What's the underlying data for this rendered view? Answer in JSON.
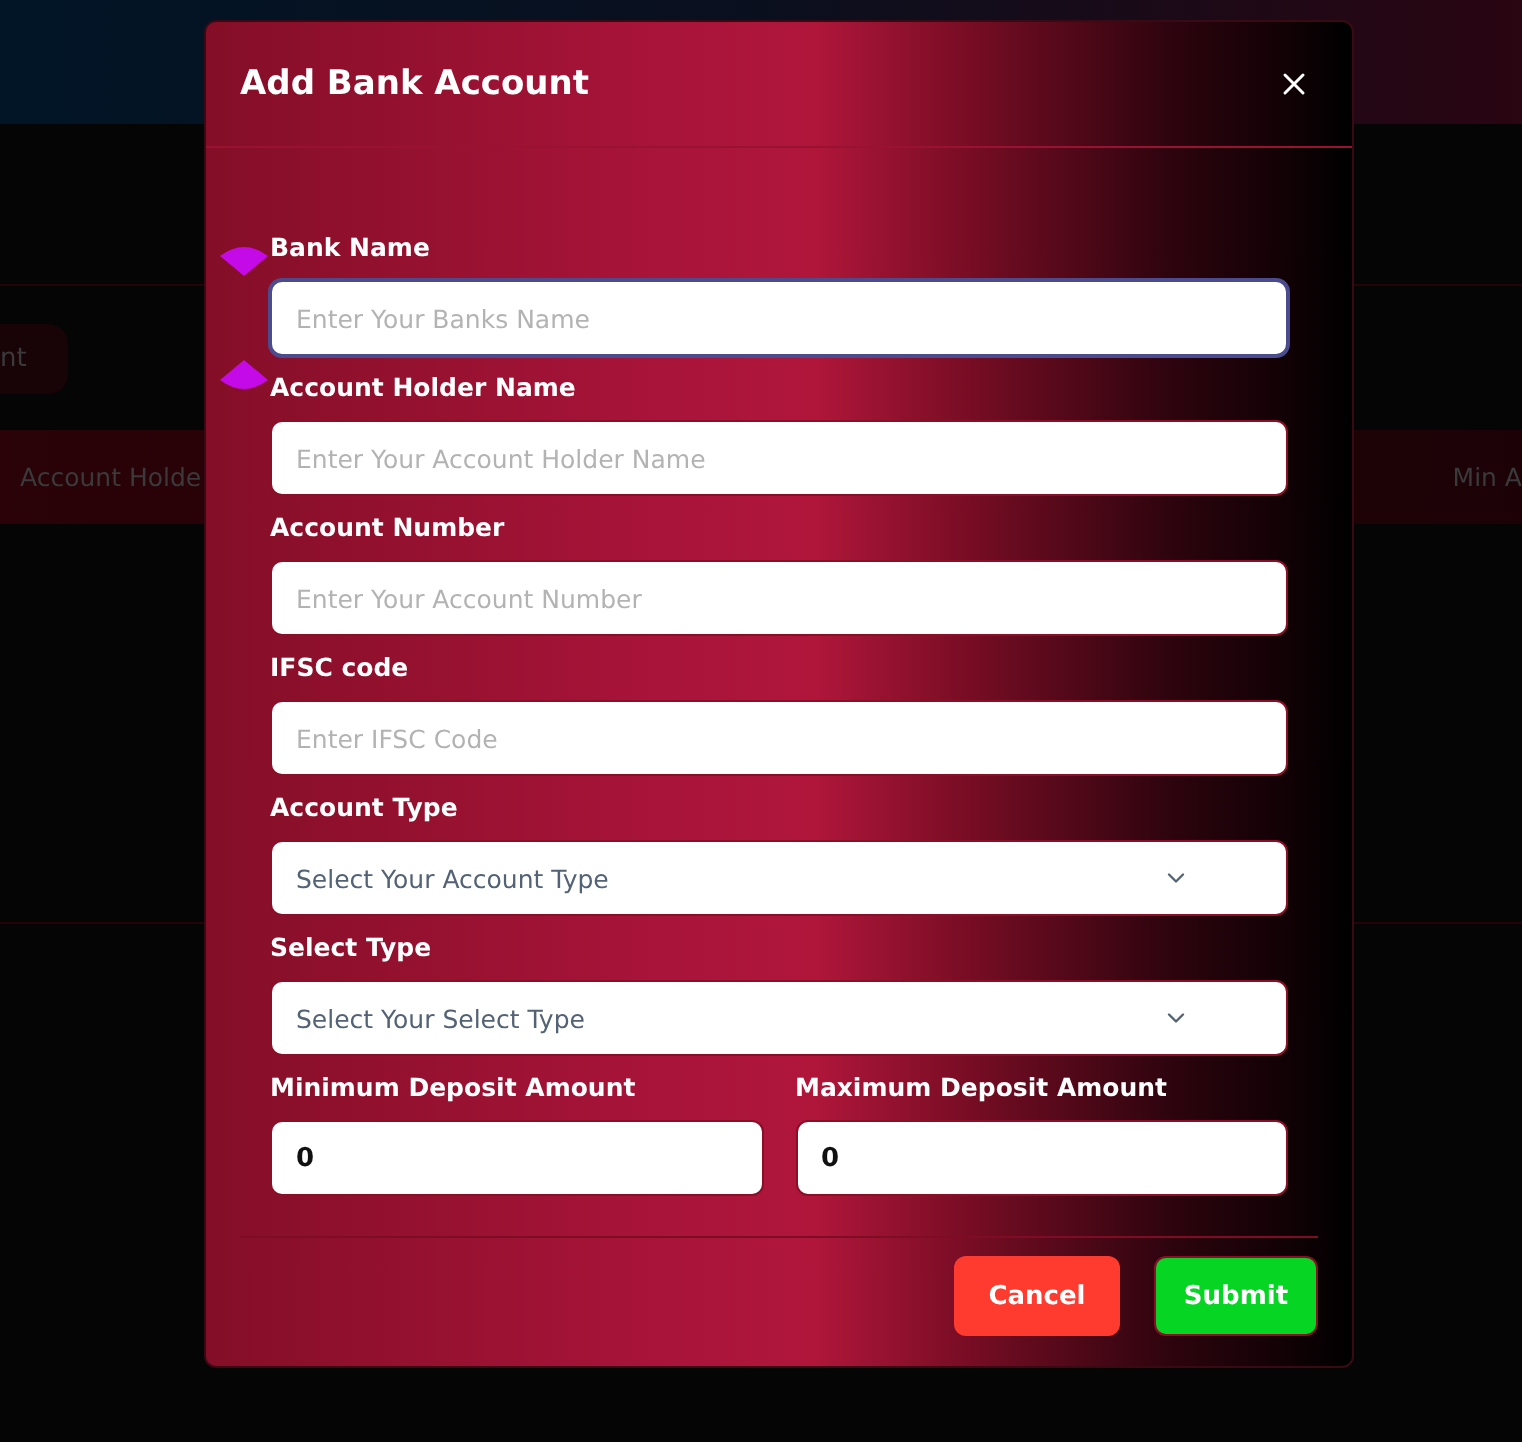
{
  "background_page": {
    "toolbar_button": {
      "label": "nt"
    },
    "table": {
      "columns": [
        {
          "label": "Account Holde"
        },
        {
          "label": "Min A"
        }
      ]
    }
  },
  "dialog": {
    "title": "Add Bank Account",
    "fields": [
      {
        "kind": "text",
        "label": "Bank Name",
        "placeholder": "Enter Your Banks Name",
        "focused": true
      },
      {
        "kind": "text",
        "label": "Account Holder Name",
        "placeholder": "Enter Your Account Holder Name",
        "focused": false
      },
      {
        "kind": "text",
        "label": "Account Number",
        "placeholder": "Enter Your Account Number",
        "focused": false
      },
      {
        "kind": "text",
        "label": "IFSC code",
        "placeholder": "Enter IFSC Code",
        "focused": false
      },
      {
        "kind": "select",
        "label": "Account Type",
        "placeholder": "Select Your Account Type",
        "focused": false
      },
      {
        "kind": "select",
        "label": "Select Type",
        "placeholder": "Select Your Select Type",
        "focused": false
      }
    ],
    "amount_fields": [
      {
        "label": "Minimum Deposit Amount",
        "value": "0"
      },
      {
        "label": "Maximum Deposit Amount",
        "value": "0"
      }
    ],
    "buttons": [
      {
        "kind": "cancel",
        "label": "Cancel"
      },
      {
        "kind": "submit",
        "label": "Submit"
      }
    ]
  }
}
